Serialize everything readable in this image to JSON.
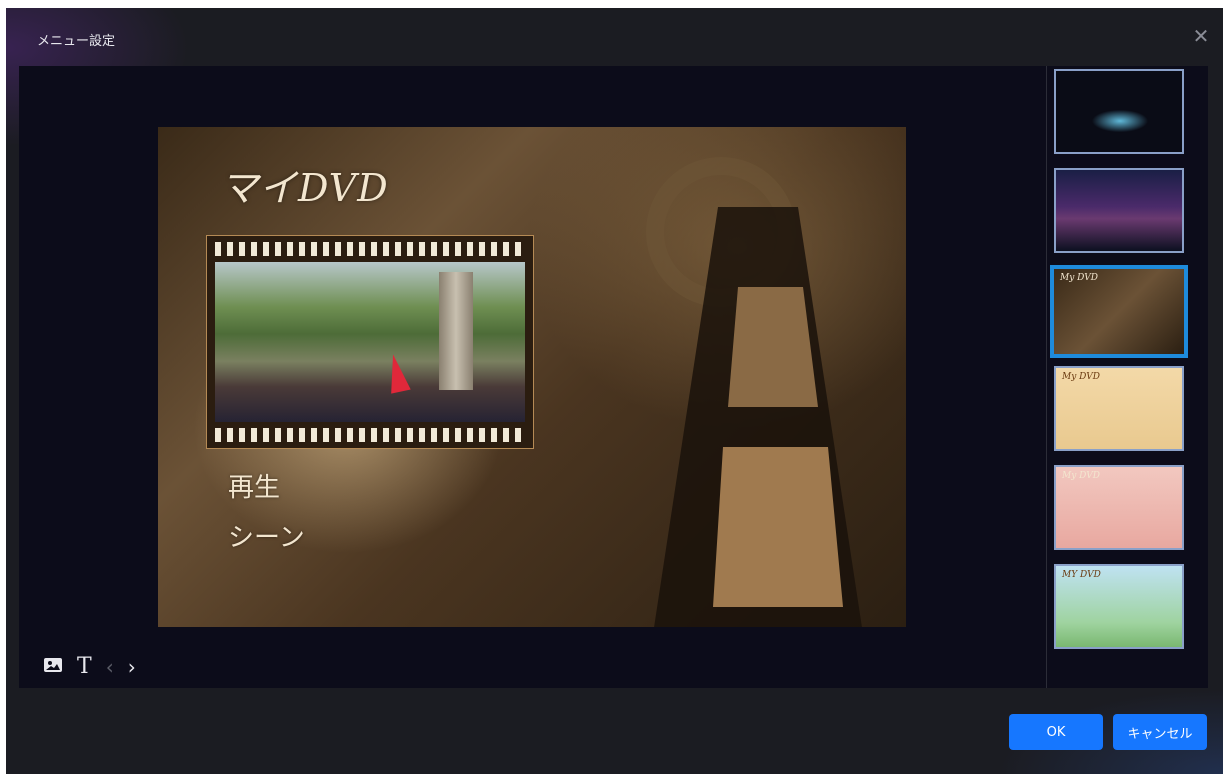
{
  "dialog": {
    "title": "メニュー設定",
    "close_icon": "close-icon"
  },
  "preview": {
    "menu_title": "マイDVD",
    "menu_items": [
      "再生",
      "シーン"
    ]
  },
  "toolbar": {
    "icons": [
      "image-icon",
      "text-icon",
      "chevron-left-icon",
      "chevron-right-icon"
    ],
    "text_glyph": "T"
  },
  "templates": {
    "selected_index": 2,
    "items": [
      {
        "caption": ""
      },
      {
        "caption": ""
      },
      {
        "caption": "My DVD"
      },
      {
        "caption": "My DVD"
      },
      {
        "caption": "My DVD"
      },
      {
        "caption": "MY DVD"
      }
    ]
  },
  "buttons": {
    "ok": "OK",
    "cancel": "キャンセル"
  },
  "colors": {
    "accent": "#1677ff",
    "selection": "#1e8bdc"
  }
}
